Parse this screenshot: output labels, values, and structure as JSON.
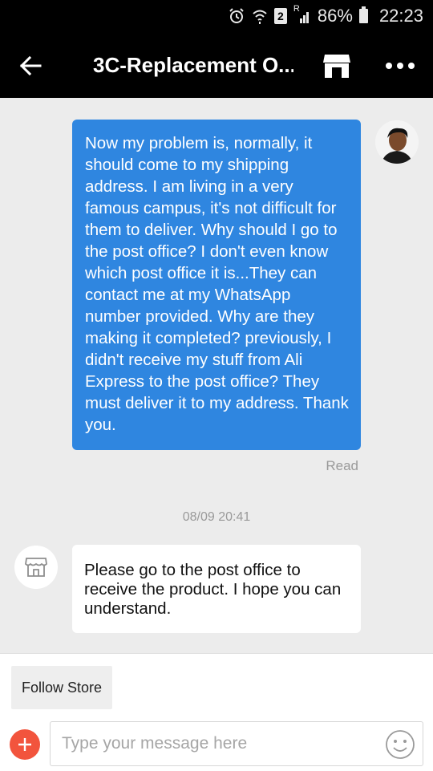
{
  "status_bar": {
    "sim_badge": "2",
    "network_label": "R",
    "battery": "86%",
    "time": "22:23"
  },
  "header": {
    "title": "3C-Replacement O..."
  },
  "messages": [
    {
      "sender": "user",
      "text": "Now my problem is, normally, it should come to my shipping address. I am living in a very famous campus, it's not difficult for them to deliver. Why should I go to the post office? I don't even know which post office it is...They can contact me at my WhatsApp number provided. Why are they making it completed? previously, I didn't receive my stuff from Ali Express to the post office? They must deliver it to my address. Thank you.",
      "status": "Read"
    },
    {
      "timestamp": "08/09 20:41"
    },
    {
      "sender": "store",
      "text": "Please go to the post office to receive the product. I hope you can understand."
    }
  ],
  "bottom_bar": {
    "follow_label": "Follow Store",
    "input_value": "",
    "input_placeholder": "Type your message here"
  },
  "colors": {
    "header_bg": "#000000",
    "outgoing_bubble": "#2f86e0",
    "incoming_bubble": "#ffffff",
    "chat_bg": "#ececec",
    "plus_button": "#f2543d"
  },
  "icons": [
    "alarm-icon",
    "wifi-icon",
    "signal-icon",
    "battery-icon",
    "back-arrow-icon",
    "store-icon",
    "more-icon",
    "plus-icon",
    "emoji-icon"
  ]
}
